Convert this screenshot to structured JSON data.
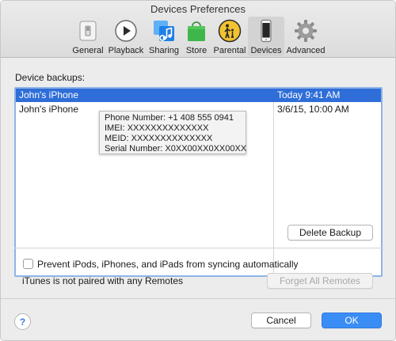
{
  "window": {
    "title": "Devices Preferences"
  },
  "toolbar": {
    "items": [
      {
        "label": "General",
        "icon": "general-switch-icon"
      },
      {
        "label": "Playback",
        "icon": "play-icon"
      },
      {
        "label": "Sharing",
        "icon": "music-note-icon"
      },
      {
        "label": "Store",
        "icon": "shopping-bag-icon"
      },
      {
        "label": "Parental",
        "icon": "parental-icon"
      },
      {
        "label": "Devices",
        "icon": "iphone-icon",
        "selected": true
      },
      {
        "label": "Advanced",
        "icon": "gear-icon"
      }
    ]
  },
  "backups": {
    "label": "Device backups:",
    "rows": [
      {
        "name": "John's iPhone",
        "date": "Today 9:41 AM",
        "selected": true
      },
      {
        "name": "John's iPhone",
        "date": "3/6/15, 10:00 AM",
        "selected": false
      }
    ],
    "tooltip": {
      "phone": "Phone Number: +1 408 555 0941",
      "imei": "IMEI: XXXXXXXXXXXXXX",
      "meid": "MEID: XXXXXXXXXXXXXX",
      "serial": "Serial Number: X0XX00XX0XX00XX"
    },
    "delete_label": "Delete Backup"
  },
  "options": {
    "prevent_sync_label": "Prevent iPods, iPhones, and iPads from syncing automatically",
    "prevent_sync_checked": false,
    "remotes_status": "iTunes is not paired with any Remotes",
    "forget_remotes_label": "Forget All Remotes"
  },
  "footer": {
    "help_label": "?",
    "cancel_label": "Cancel",
    "ok_label": "OK"
  },
  "colors": {
    "accent": "#2f6ed8",
    "ok_button": "#3b8df6",
    "store_green": "#3fb64a",
    "parental_yellow": "#f2c230",
    "sharing_blue": "#2a8ef0"
  }
}
